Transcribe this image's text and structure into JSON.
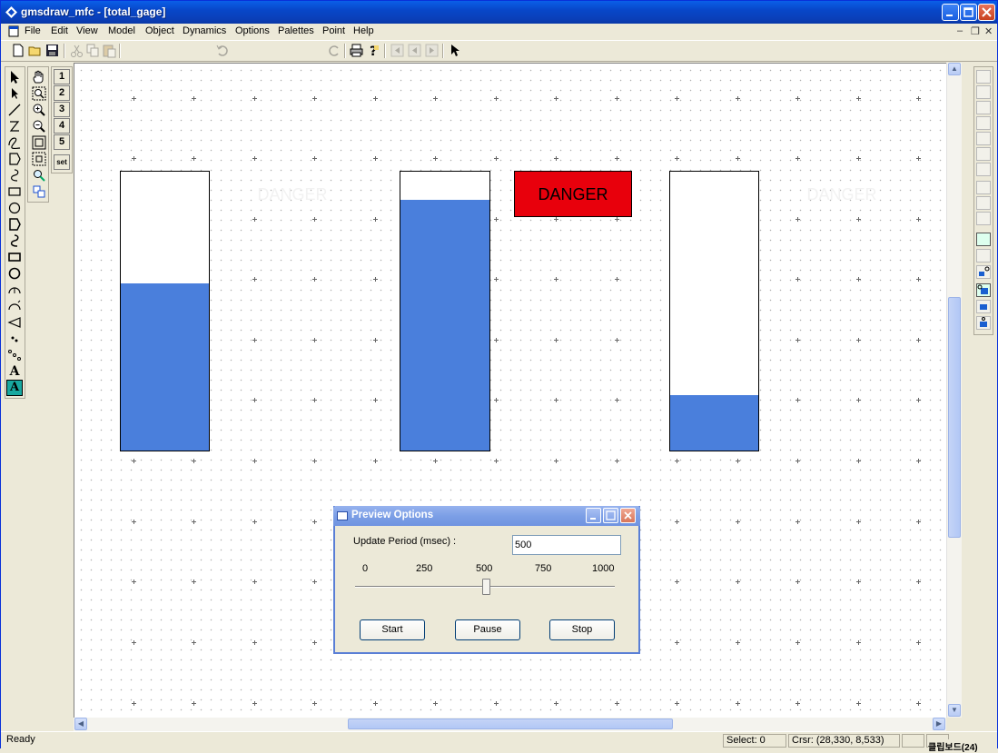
{
  "window": {
    "title": "gmsdraw_mfc - [total_gage]"
  },
  "menu": [
    "File",
    "Edit",
    "View",
    "Model",
    "Object",
    "Dynamics",
    "Options",
    "Palettes",
    "Point",
    "Help"
  ],
  "palette": {
    "numbers": [
      "1",
      "2",
      "3",
      "4",
      "5"
    ],
    "set_label": "set",
    "text_tool": "A"
  },
  "canvas": {
    "gages": [
      {
        "level": 0.6
      },
      {
        "level": 0.9
      },
      {
        "level": 0.2
      }
    ],
    "danger_labels": [
      {
        "text": "DANGER",
        "active": false
      },
      {
        "text": "DANGER",
        "active": true
      },
      {
        "text": "DANGER",
        "active": false
      }
    ]
  },
  "dialog": {
    "title": "Preview Options",
    "update_label": "Update Period (msec) :",
    "update_value": "500",
    "ticks": [
      "0",
      "250",
      "500",
      "750",
      "1000"
    ],
    "slider_value": 500,
    "buttons": {
      "start": "Start",
      "pause": "Pause",
      "stop": "Stop"
    }
  },
  "status": {
    "ready": "Ready",
    "select": "Select: 0",
    "cursor": "Crsr: (28,330,  8,533)",
    "clipboard": "클립보드(24)"
  },
  "colors": {
    "gage_fill": "#4a7fdc",
    "danger_on": "#e8000c"
  }
}
